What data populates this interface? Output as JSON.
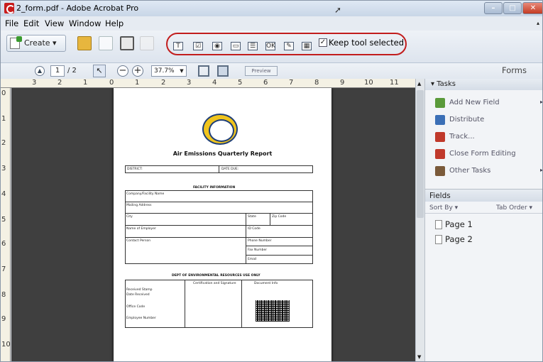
{
  "window": {
    "title": "2_form.pdf - Adobe Acrobat Pro",
    "buttons": {
      "minimize": "–",
      "maximize": "□",
      "close": "✕"
    }
  },
  "menu": {
    "items": [
      {
        "label": "File"
      },
      {
        "label": "Edit"
      },
      {
        "label": "View"
      },
      {
        "label": "Window"
      },
      {
        "label": "Help"
      }
    ],
    "overflow_arrow": "▴"
  },
  "toolbar": {
    "create_label": "Create ▾",
    "form_tools": [
      "T",
      "☑",
      "◉",
      "▭",
      "☰",
      "OK",
      "✎",
      "▦"
    ],
    "keep_tool_checked": "✓",
    "keep_tool_label": "Keep tool selected"
  },
  "nav": {
    "current_page": "1",
    "page_count": "/ 2",
    "zoom": "37.7%",
    "preview_label": "Preview",
    "forms_tab": "Forms"
  },
  "rulers": {
    "horizontal": [
      "3",
      "2",
      "1",
      "0",
      "1",
      "2",
      "3",
      "4",
      "5",
      "6",
      "7",
      "8",
      "9",
      "10",
      "11"
    ],
    "vertical": [
      "0",
      "1",
      "2",
      "3",
      "4",
      "5",
      "6",
      "7",
      "8",
      "9",
      "10"
    ]
  },
  "document": {
    "title": "Air Emissions Quarterly Report",
    "row1": {
      "left": "DISTRICT:",
      "right": "DATE DUE:"
    },
    "facility_section": "FACILITY INFORMATION",
    "facility_fields": [
      "Company/Facility Name",
      "Mailing Address",
      "City",
      "State",
      "Zip Code",
      "Name of Employer",
      "ID Code",
      "Contact Person",
      "Phone Number",
      "Fax Number",
      "Email"
    ],
    "dept_section": "DEPT OF ENVIRONMENTAL RESOURCES USE ONLY",
    "dept_headers": [
      "Certification and Signature",
      "Document Info"
    ],
    "dept_left_lines": [
      "Received Stamp",
      "Date Received",
      "Office Code",
      "Employee Number"
    ]
  },
  "tasks_panel": {
    "header": "▾ Tasks",
    "items": [
      {
        "label": "Add New Field",
        "caret": "▸",
        "icon_color": "#5a9a3a"
      },
      {
        "label": "Distribute",
        "caret": "",
        "icon_color": "#3b6fb6"
      },
      {
        "label": "Track...",
        "caret": "",
        "icon_color": "#c0392b"
      },
      {
        "label": "Close Form Editing",
        "caret": "",
        "icon_color": "#c0392b"
      },
      {
        "label": "Other Tasks",
        "caret": "▸",
        "icon_color": "#7a5a3a"
      }
    ]
  },
  "fields_panel": {
    "header": "Fields",
    "sort_by": "Sort By ▾",
    "tab_order": "Tab Order ▾",
    "pages": [
      "Page 1",
      "Page 2"
    ]
  }
}
